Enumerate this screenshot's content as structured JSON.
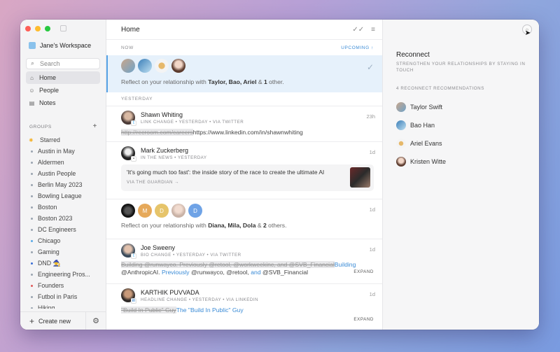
{
  "sidebar": {
    "workspace": "Jane's Workspace",
    "search_placeholder": "Search",
    "nav": [
      {
        "label": "Home",
        "icon": "home-icon"
      },
      {
        "label": "People",
        "icon": "people-icon"
      },
      {
        "label": "Notes",
        "icon": "notes-icon"
      }
    ],
    "groups_label": "GROUPS",
    "groups": [
      {
        "label": "Starred",
        "color": "#f5b73b"
      },
      {
        "label": "Austin in May",
        "color": "#9aa4b0"
      },
      {
        "label": "Aldermen",
        "color": "#9aa4b0"
      },
      {
        "label": "Austin People",
        "color": "#9aa4b0"
      },
      {
        "label": "Berlin May 2023",
        "color": "#9aa4b0"
      },
      {
        "label": "Bowling League",
        "color": "#9aa4b0"
      },
      {
        "label": "Boston",
        "color": "#9aa4b0"
      },
      {
        "label": "Boston 2023",
        "color": "#9aa4b0"
      },
      {
        "label": "DC Engineers",
        "color": "#9aa4b0"
      },
      {
        "label": "Chicago",
        "color": "#5aa9e6"
      },
      {
        "label": "Gaming",
        "color": "#9aa4b0"
      },
      {
        "label": "DND 🧙",
        "color": "#3b6fd6"
      },
      {
        "label": "Engineering Pros...",
        "color": "#9aa4b0"
      },
      {
        "label": "Founders",
        "color": "#e05a5a"
      },
      {
        "label": "Futbol in Paris",
        "color": "#9aa4b0"
      },
      {
        "label": "Hiking",
        "color": "#9aa4b0"
      }
    ],
    "create_label": "Create new"
  },
  "main": {
    "title": "Home",
    "now_label": "NOW",
    "upcoming_label": "UPCOMING ↑",
    "yesterday_label": "YESTERDAY",
    "reflect1": {
      "prefix": "Reflect on your relationship with ",
      "names": "Taylor, Bao, Ariel",
      "mid": " & ",
      "count": "1",
      "suffix": " other."
    },
    "shawn": {
      "name": "Shawn Whiting",
      "meta": "LINK CHANGE • YESTERDAY • VIA TWITTER",
      "when": "23h",
      "old": "http://recroom.com/careers",
      "new": "https://www.linkedin.com/in/shawnwhiting"
    },
    "mark": {
      "name": "Mark Zuckerberg",
      "meta": "IN THE NEWS • YESTERDAY",
      "when": "1d",
      "news_title": "'It's going much too fast': the inside story of the race to create the ultimate AI",
      "news_via": "VIA THE GUARDIAN →"
    },
    "reflect2": {
      "when": "1d",
      "prefix": "Reflect on your relationship with ",
      "names": "Diana, Mila, Dola",
      "mid": " & ",
      "count": "2",
      "suffix": " others."
    },
    "joe": {
      "name": "Joe Sweeny",
      "meta": "BIO CHANGE • YESTERDAY • VIA TWITTER",
      "when": "1d",
      "old1": "Building @runwayco. Previously @retool, @workweekinc, and @SVB_Financial",
      "new1": "Building",
      "line2a": "@AnthropicAI. ",
      "line2b": "Previously",
      "line2c": " @runwayco, @retool, ",
      "line2d": "and",
      "line2e": " @SVB_Financial",
      "expand": "EXPAND"
    },
    "karthik": {
      "name": "KARTHIK PUVVADA",
      "meta": "HEADLINE CHANGE • YESTERDAY • VIA LINKEDIN",
      "when": "1d",
      "old": "\"Build In Public\" Guy",
      "new": "The \"Build In Public\" Guy",
      "expand": "EXPAND"
    }
  },
  "reconnect": {
    "title": "Reconnect",
    "subtitle": "STRENGTHEN YOUR RELATIONSHIPS BY STAYING IN TOUCH",
    "count_label": "4 RECONNECT RECOMMENDATIONS",
    "people": [
      "Taylor Swift",
      "Bao Han",
      "Ariel Evans",
      "Kristen Witte"
    ]
  }
}
